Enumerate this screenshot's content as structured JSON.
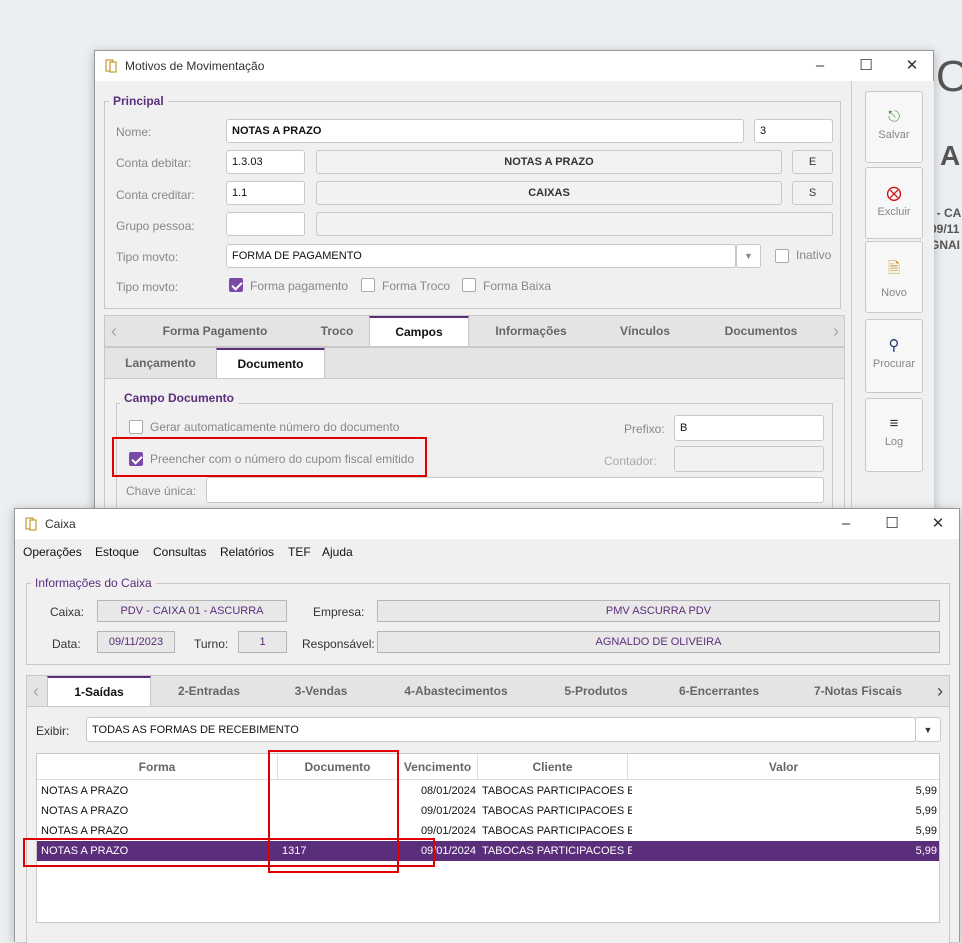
{
  "background": {
    "text_a": "O",
    "text_b": "AIX",
    "text_c": "/ - CA",
    "text_d": "09/11",
    "text_e": "GNAI"
  },
  "motivos": {
    "title": "Motivos de Movimentação",
    "principal_group": "Principal",
    "nome_label": "Nome:",
    "nome_value": "NOTAS A PRAZO",
    "nome_code": "3",
    "debitar_label": "Conta debitar:",
    "debitar_code": "1.3.03",
    "debitar_desc": "NOTAS A PRAZO",
    "debitar_flag": "E",
    "creditar_label": "Conta creditar:",
    "creditar_code": "1.1",
    "creditar_desc": "CAIXAS",
    "creditar_flag": "S",
    "grupo_label": "Grupo pessoa:",
    "grupo_code": "",
    "grupo_desc": "",
    "tipo1_label": "Tipo movto:",
    "tipo1_value": "FORMA DE PAGAMENTO",
    "inativo_label": "Inativo",
    "tipo2_label": "Tipo movto:",
    "cb_forma_pagamento": "Forma pagamento",
    "cb_forma_troco": "Forma Troco",
    "cb_forma_baixa": "Forma Baixa",
    "tabs": [
      "Forma Pagamento",
      "Troco",
      "Campos",
      "Informações",
      "Vínculos",
      "Documentos"
    ],
    "subtabs": [
      "Lançamento",
      "Documento"
    ],
    "campo_group": "Campo Documento",
    "cb_gerar": "Gerar automaticamente número do documento",
    "cb_preencher": "Preencher com o número do cupom fiscal emitido",
    "prefixo_label": "Prefixo:",
    "prefixo_value": "B",
    "contador_label": "Contador:",
    "chave_label": "Chave única:",
    "side": {
      "salvar": "Salvar",
      "excluir": "Excluir",
      "novo": "Novo",
      "procurar": "Procurar",
      "log": "Log"
    }
  },
  "caixa": {
    "title": "Caixa",
    "menu": [
      "Operações",
      "Estoque",
      "Consultas",
      "Relatórios",
      "TEF",
      "Ajuda"
    ],
    "info_group": "Informações do Caixa",
    "caixa_label": "Caixa:",
    "caixa_value": "PDV - CAIXA 01 - ASCURRA",
    "empresa_label": "Empresa:",
    "empresa_value": "PMV ASCURRA PDV",
    "data_label": "Data:",
    "data_value": "09/11/2023",
    "turno_label": "Turno:",
    "turno_value": "1",
    "resp_label": "Responsável:",
    "resp_value": "AGNALDO DE OLIVEIRA",
    "tabs": [
      "1-Saídas",
      "2-Entradas",
      "3-Vendas",
      "4-Abastecimentos",
      "5-Produtos",
      "6-Encerrantes",
      "7-Notas Fiscais"
    ],
    "exibir_label": "Exibir:",
    "exibir_value": "TODAS AS FORMAS DE RECEBIMENTO",
    "columns": [
      "Forma",
      "Documento",
      "Vencimento",
      "Cliente",
      "Valor"
    ],
    "rows": [
      {
        "forma": "NOTAS A PRAZO",
        "documento": "",
        "vencimento": "08/01/2024",
        "cliente": "TABOCAS PARTICIPACOES E",
        "valor": "5,99"
      },
      {
        "forma": "NOTAS A PRAZO",
        "documento": "",
        "vencimento": "09/01/2024",
        "cliente": "TABOCAS PARTICIPACOES E",
        "valor": "5,99"
      },
      {
        "forma": "NOTAS A PRAZO",
        "documento": "",
        "vencimento": "09/01/2024",
        "cliente": "TABOCAS PARTICIPACOES E",
        "valor": "5,99"
      },
      {
        "forma": "NOTAS A PRAZO",
        "documento": "1317",
        "vencimento": "09/01/2024",
        "cliente": "TABOCAS PARTICIPACOES E",
        "valor": "5,99"
      }
    ]
  },
  "colors": {
    "accent": "#5b2e7c",
    "highlight": "#e00000"
  }
}
